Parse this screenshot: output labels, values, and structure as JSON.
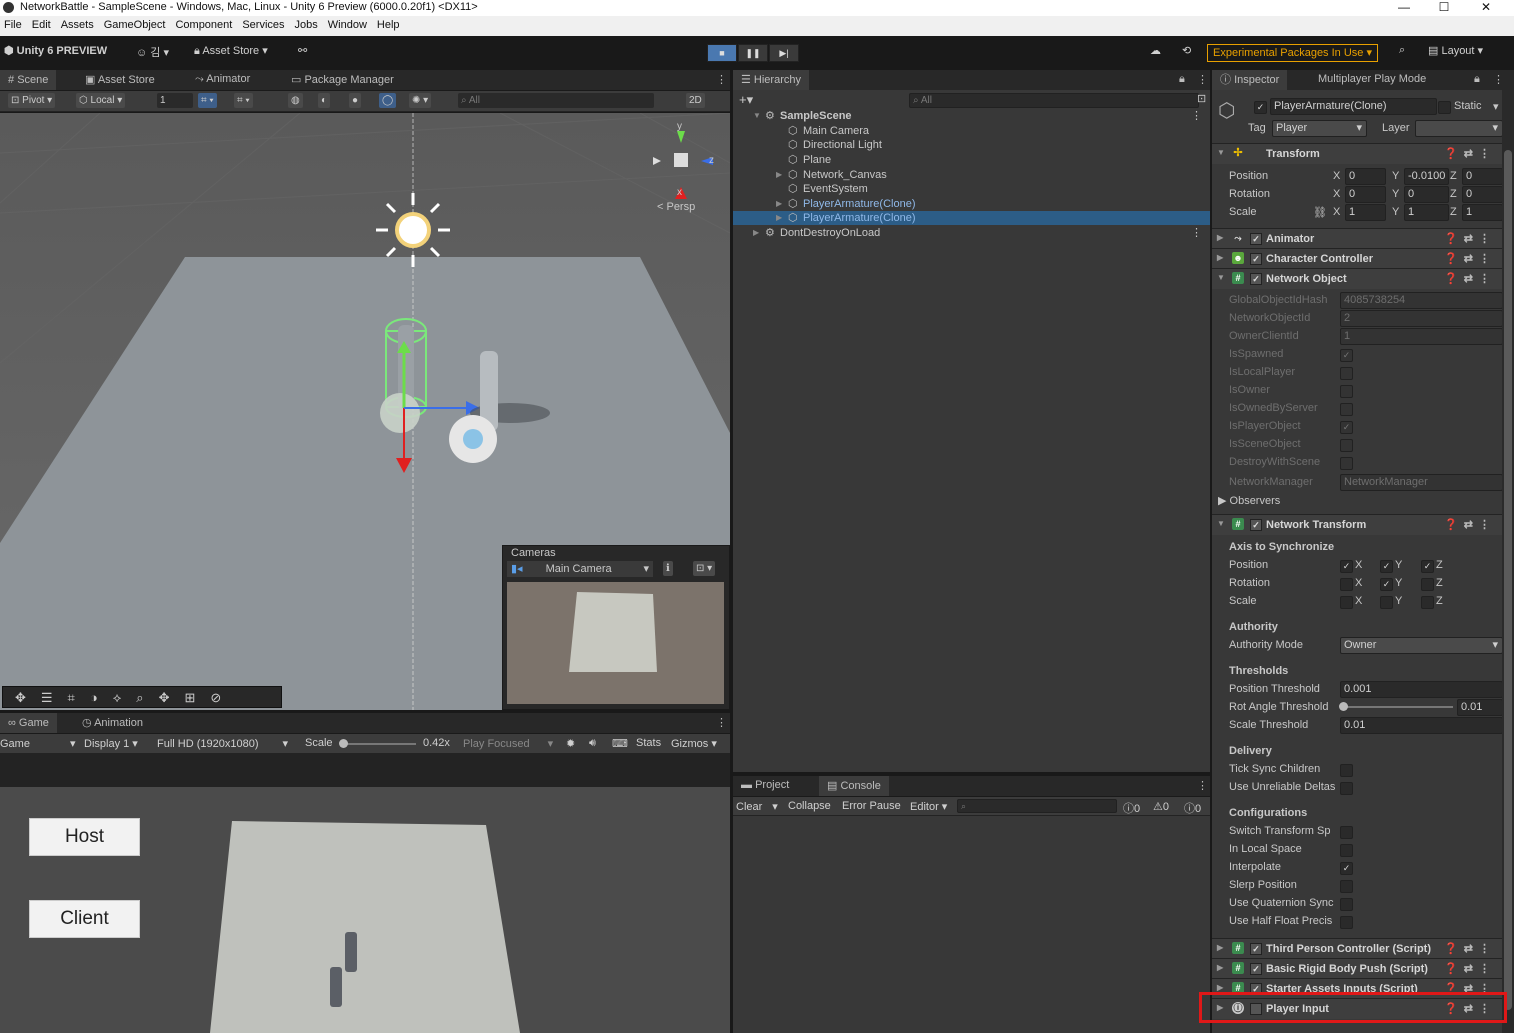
{
  "window": {
    "title": "NetworkBattle - SampleScene - Windows, Mac, Linux - Unity 6 Preview (6000.0.20f1) <DX11>"
  },
  "menu": [
    "File",
    "Edit",
    "Assets",
    "GameObject",
    "Component",
    "Services",
    "Jobs",
    "Window",
    "Help"
  ],
  "toolbar": {
    "brand": "Unity 6 PREVIEW",
    "account": "김",
    "asset_store": "Asset Store",
    "experimental": "Experimental Packages In Use",
    "layout": "Layout"
  },
  "scene_tabs": [
    "Scene",
    "Asset Store",
    "Animator",
    "Package Manager"
  ],
  "scene_toolbar": {
    "pivot": "Pivot",
    "local": "Local",
    "grid_value": "1",
    "search_placeholder": "All",
    "mode_2d": "2D"
  },
  "gizmo": {
    "y": "y",
    "z": "z",
    "x": "x",
    "persp": "< Persp"
  },
  "cameras_overlay": {
    "title": "Cameras",
    "camera": "Main Camera"
  },
  "game_tabs": [
    "Game",
    "Animation"
  ],
  "game_toolbar": {
    "view": "Game",
    "display": "Display 1",
    "resolution": "Full HD (1920x1080)",
    "scale_label": "Scale",
    "scale_value": "0.42x",
    "play_mode": "Play Focused",
    "stats": "Stats",
    "gizmos": "Gizmos"
  },
  "game_buttons": {
    "host": "Host",
    "client": "Client"
  },
  "hierarchy": {
    "tab": "Hierarchy",
    "search_placeholder": "All",
    "items": [
      {
        "label": "SampleScene",
        "depth": 0
      },
      {
        "label": "Main Camera",
        "depth": 1
      },
      {
        "label": "Directional Light",
        "depth": 1
      },
      {
        "label": "Plane",
        "depth": 1
      },
      {
        "label": "Network_Canvas",
        "depth": 1
      },
      {
        "label": "EventSystem",
        "depth": 1
      },
      {
        "label": "PlayerArmature(Clone)",
        "depth": 1
      },
      {
        "label": "PlayerArmature(Clone)",
        "depth": 1,
        "selected": true
      },
      {
        "label": "DontDestroyOnLoad",
        "depth": 0
      }
    ]
  },
  "bottom_tabs": [
    "Project",
    "Console"
  ],
  "console_toolbar": {
    "clear": "Clear",
    "collapse": "Collapse",
    "error_pause": "Error Pause",
    "editor": "Editor",
    "count_info": "0",
    "count_warn": "0",
    "count_error": "0"
  },
  "inspector": {
    "tabs": [
      "Inspector",
      "Multiplayer Play Mode"
    ],
    "object_name": "PlayerArmature(Clone)",
    "static_label": "Static",
    "tag_label": "Tag",
    "tag_value": "Player",
    "layer_label": "Layer",
    "layer_value": "",
    "transform": {
      "title": "Transform",
      "position": {
        "label": "Position",
        "x": "0",
        "y": "-0.0100",
        "z": "0"
      },
      "rotation": {
        "label": "Rotation",
        "x": "0",
        "y": "0",
        "z": "0"
      },
      "scale": {
        "label": "Scale",
        "x": "1",
        "y": "1",
        "z": "1"
      },
      "axis_x": "X",
      "axis_y": "Y",
      "axis_z": "Z"
    },
    "components_collapsed": [
      "Animator",
      "Character Controller"
    ],
    "network_object": {
      "title": "Network Object",
      "fields": [
        {
          "label": "GlobalObjectIdHash",
          "value": "4085738254"
        },
        {
          "label": "NetworkObjectId",
          "value": "2"
        },
        {
          "label": "OwnerClientId",
          "value": "1"
        }
      ],
      "flags": [
        {
          "label": "IsSpawned",
          "checked": true
        },
        {
          "label": "IsLocalPlayer",
          "checked": false
        },
        {
          "label": "IsOwner",
          "checked": false
        },
        {
          "label": "IsOwnedByServer",
          "checked": false
        },
        {
          "label": "IsPlayerObject",
          "checked": true
        },
        {
          "label": "IsSceneObject",
          "checked": false
        },
        {
          "label": "DestroyWithScene",
          "checked": false
        }
      ],
      "manager_label": "NetworkManager",
      "manager_value": "NetworkManager",
      "observers": "Observers"
    },
    "network_transform": {
      "title": "Network Transform",
      "axis_header": "Axis to Synchronize",
      "axes": [
        {
          "label": "Position",
          "x": true,
          "y": true,
          "z": true
        },
        {
          "label": "Rotation",
          "x": false,
          "y": true,
          "z": false
        },
        {
          "label": "Scale",
          "x": false,
          "y": false,
          "z": false
        }
      ],
      "authority_header": "Authority",
      "authority_mode_label": "Authority Mode",
      "authority_mode_value": "Owner",
      "thresholds_header": "Thresholds",
      "position_threshold_label": "Position Threshold",
      "position_threshold": "0.001",
      "rot_threshold_label": "Rot Angle Threshold",
      "rot_threshold": "0.01",
      "scale_threshold_label": "Scale Threshold",
      "scale_threshold": "0.01",
      "delivery_header": "Delivery",
      "delivery": [
        {
          "label": "Tick Sync Children",
          "checked": false
        },
        {
          "label": "Use Unreliable Deltas",
          "checked": false
        }
      ],
      "config_header": "Configurations",
      "config": [
        {
          "label": "Switch Transform Sp",
          "checked": false
        },
        {
          "label": "In Local Space",
          "checked": false
        },
        {
          "label": "Interpolate",
          "checked": true
        },
        {
          "label": "Slerp Position",
          "checked": false
        },
        {
          "label": "Use Quaternion Sync",
          "checked": false
        },
        {
          "label": "Use Half Float Precis",
          "checked": false
        }
      ]
    },
    "scripts": [
      "Third Person Controller (Script)",
      "Basic Rigid Body Push (Script)",
      "Starter Assets Inputs (Script)"
    ],
    "player_input": "Player Input"
  }
}
